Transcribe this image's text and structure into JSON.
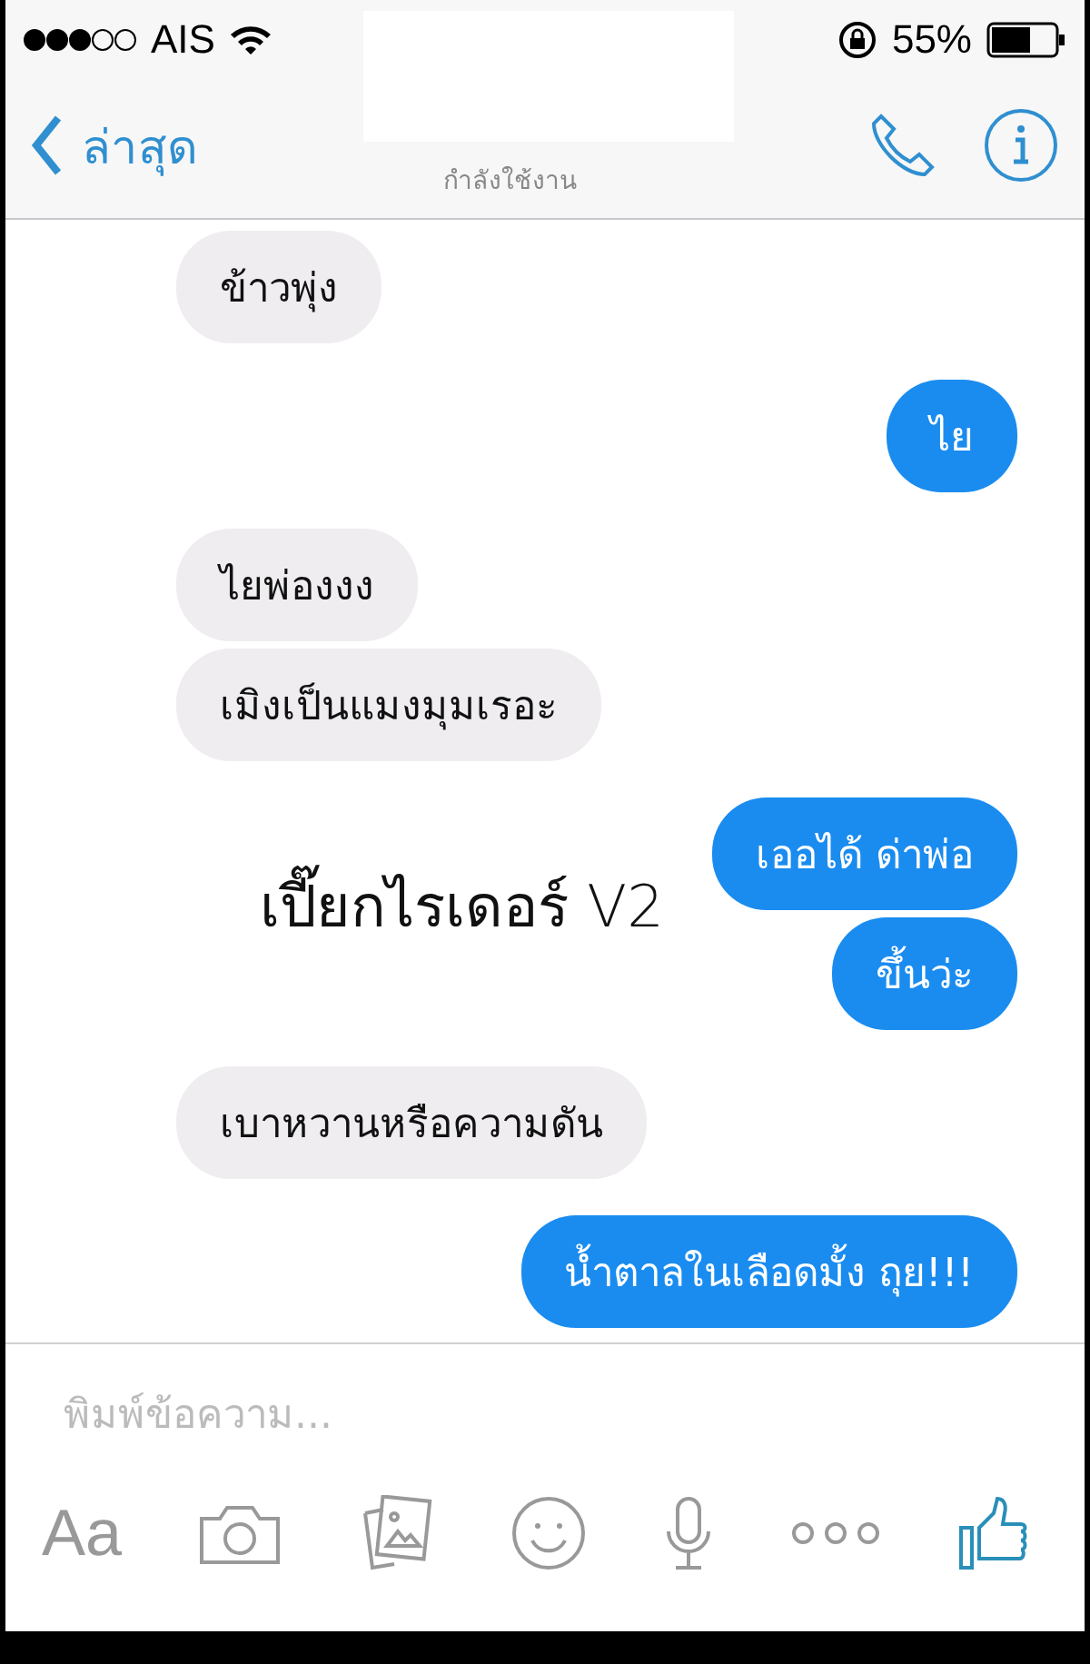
{
  "status_bar": {
    "carrier": "AIS",
    "battery": "55%"
  },
  "nav": {
    "back": "ล่าสุด",
    "subtitle": "กำลังใช้งาน"
  },
  "groups": [
    {
      "kind": "received",
      "messages": [
        "ข้าวพุ่ง"
      ]
    },
    {
      "kind": "sent",
      "messages": [
        "ไย"
      ]
    },
    {
      "kind": "received",
      "messages": [
        "ไยพ่องงง",
        "เมิงเป็นแมงมุมเรอะ"
      ]
    },
    {
      "kind": "sent",
      "messages": [
        "เออได้ ด่าพ่อ",
        "ขึ้นว่ะ"
      ]
    },
    {
      "kind": "received",
      "messages": [
        "เบาหวานหรือความดัน"
      ]
    },
    {
      "kind": "sent",
      "messages": [
        "น้ำตาลในเลือดมั้ง ถุย!!!"
      ]
    }
  ],
  "caption": "เปี๊ยกไรเดอร์ V2",
  "composer": {
    "placeholder": "พิมพ์ข้อความ...",
    "text_button": "Aa"
  }
}
